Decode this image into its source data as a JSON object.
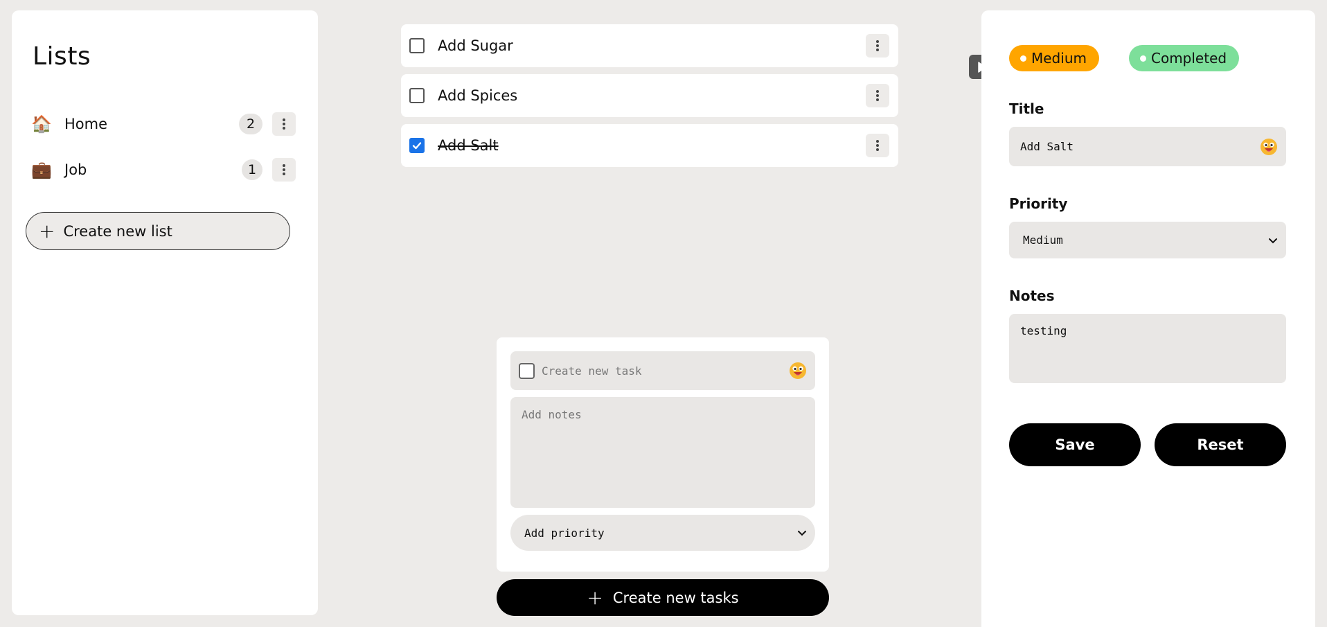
{
  "sidebar": {
    "title": "Lists",
    "lists": [
      {
        "emoji": "🏠",
        "name": "Home",
        "count": "2"
      },
      {
        "emoji": "💼",
        "name": "Job",
        "count": "1"
      }
    ],
    "create_label": "Create new list"
  },
  "tasks": [
    {
      "name": "Add Sugar",
      "done": false
    },
    {
      "name": "Add Spices",
      "done": false
    },
    {
      "name": "Add Salt",
      "done": true
    }
  ],
  "create_task": {
    "title_placeholder": "Create new task",
    "notes_placeholder": "Add notes",
    "priority_placeholder": "Add priority",
    "button_label": "Create new tasks"
  },
  "detail": {
    "priority_badge": "Medium",
    "status_badge": "Completed",
    "title_label": "Title",
    "title_value": "Add Salt",
    "priority_label": "Priority",
    "priority_value": "Medium",
    "notes_label": "Notes",
    "notes_value": "testing",
    "save_label": "Save",
    "reset_label": "Reset"
  },
  "colors": {
    "medium": "#ffa500",
    "completed": "#7ddf9a",
    "checkbox_checked": "#1a73e8",
    "background": "#edebe9"
  },
  "icons": {
    "emoji_picker": "emoji-face-icon",
    "more": "more-vertical-icon",
    "collapse": "play-arrow-icon",
    "dropdown": "chevron-down-icon"
  }
}
